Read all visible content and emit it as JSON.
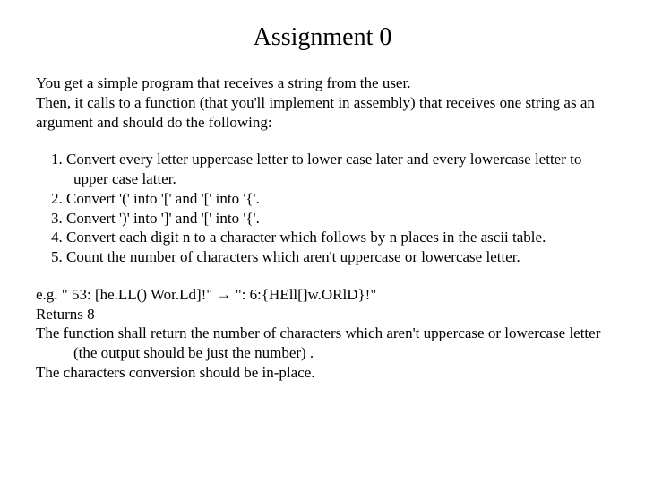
{
  "title": "Assignment 0",
  "intro": {
    "line1": "You get a simple program that receives a string from the user.",
    "line2": "Then, it calls to a function (that you'll implement in assembly) that receives one string as an argument and should do the following:"
  },
  "list": {
    "item1": "1. Convert every letter uppercase letter to lower case later and every  lowercase letter to upper case latter.",
    "item2": "2. Convert '(' into '[' and '[' into '{'.",
    "item3": "3. Convert ')' into ']' and '[' into '{'.",
    "item4": "4. Convert each digit n to a character which follows by n places in the ascii table.",
    "item5": "5. Count the number of characters which aren't uppercase or lowercase letter."
  },
  "notes": {
    "example": "e.g. \" 53: [he.LL() Wor.Ld]!\" → \": 6:{HEll[]w.ORlD}!\"",
    "returns": "Returns 8",
    "ret_desc": "The function shall return the number of characters which aren't uppercase or lowercase letter (the output should be just the number) .",
    "inplace": "The characters conversion should be in-place."
  }
}
